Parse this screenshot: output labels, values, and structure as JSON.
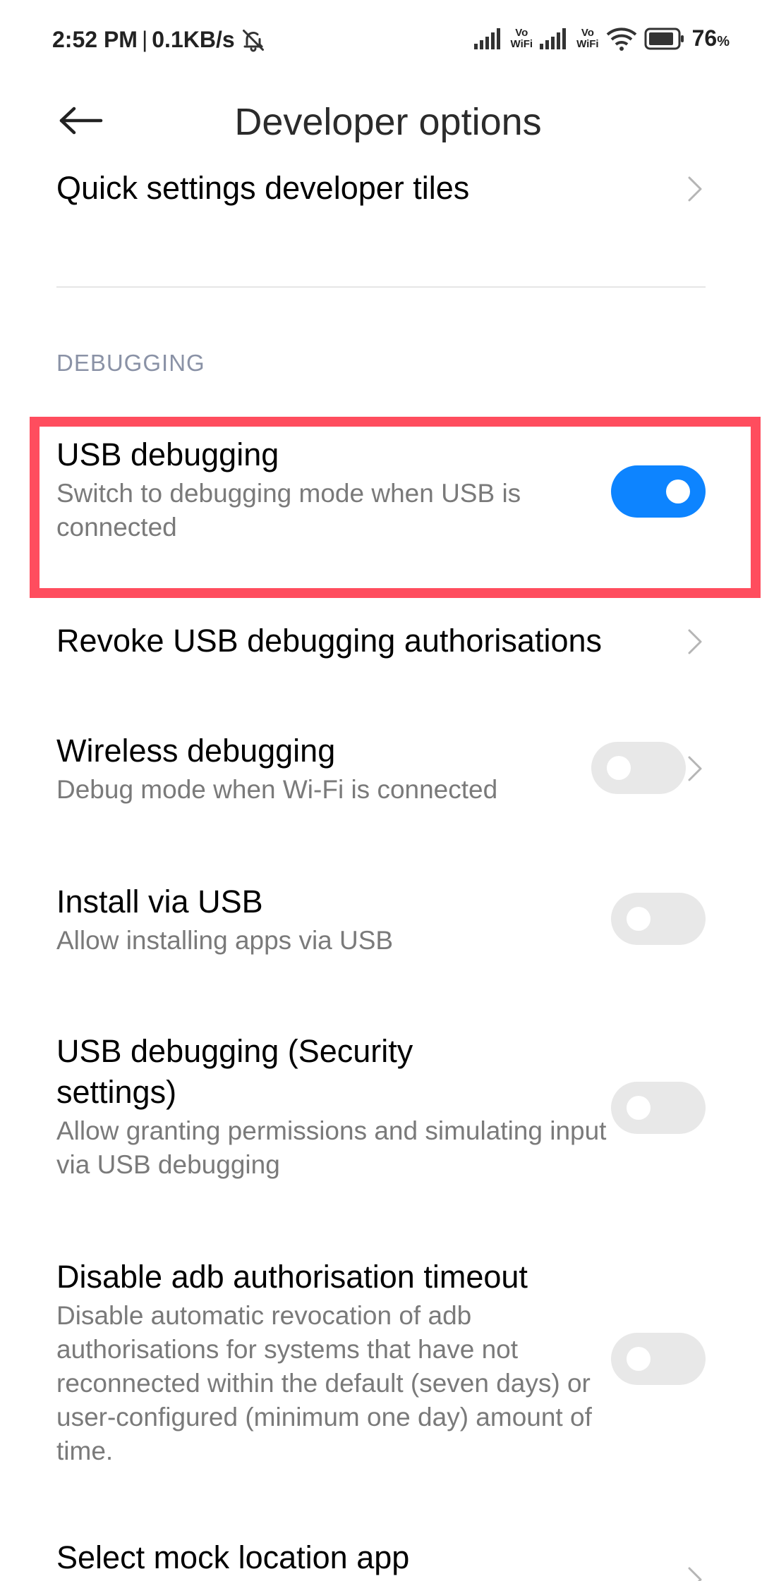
{
  "status_bar": {
    "time": "2:52 PM",
    "separator": "|",
    "network_speed": "0.1KB/s",
    "vo_label": "Vo",
    "wifi_label": "WiFi",
    "battery_percent": "76",
    "battery_unit": "%"
  },
  "header": {
    "title": "Developer options"
  },
  "section": {
    "debugging_label": "DEBUGGING"
  },
  "items": [
    {
      "title": "Quick settings developer tiles"
    },
    {
      "title": "USB debugging",
      "subtitle": "Switch to debugging mode when USB is connected",
      "enabled": true
    },
    {
      "title": "Revoke USB debugging authorisations"
    },
    {
      "title": "Wireless debugging",
      "subtitle": "Debug mode when Wi-Fi is connected",
      "enabled": false
    },
    {
      "title": "Install via USB",
      "subtitle": "Allow installing apps via USB",
      "enabled": false
    },
    {
      "title": "USB debugging (Security settings)",
      "subtitle": "Allow granting permissions and simulating input via USB debugging",
      "enabled": false
    },
    {
      "title": "Disable adb authorisation timeout",
      "subtitle": "Disable automatic revocation of adb authorisations for systems that have not reconnected within the default (seven days) or user-configured (minimum one day) amount of time.",
      "enabled": false
    },
    {
      "title": "Select mock location app"
    }
  ],
  "colors": {
    "toggle_on": "#0d84ff",
    "toggle_off": "#e8e8e8",
    "highlight": "#ff4d5e",
    "section_header": "#8a92a6"
  }
}
